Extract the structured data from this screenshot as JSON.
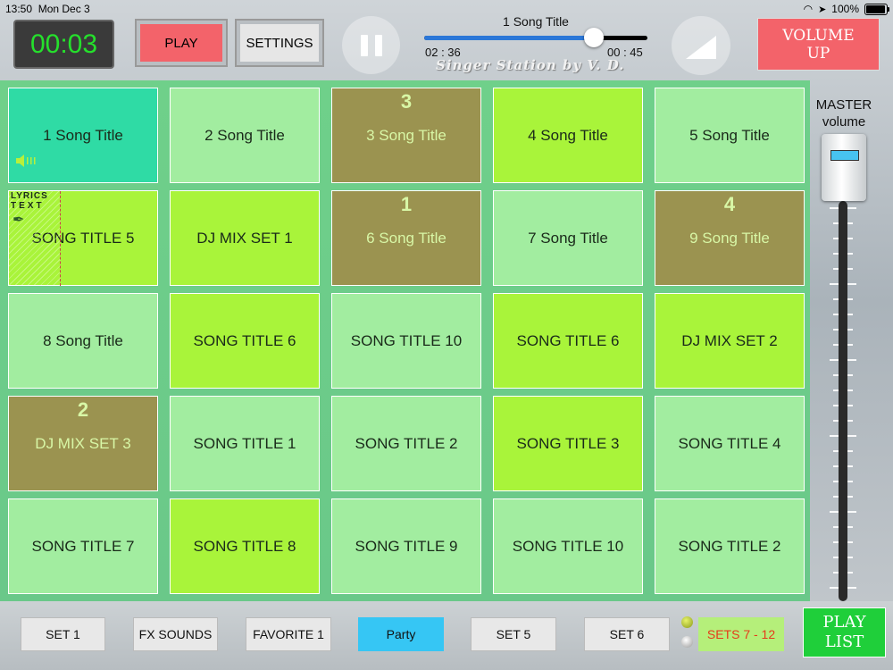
{
  "status_bar": {
    "time": "13:50",
    "date": "Mon Dec 3",
    "battery": "100%"
  },
  "timer": "00:03",
  "controls": {
    "play_label": "PLAY",
    "settings_label": "SETTINGS",
    "volume_up_label": "VOLUME UP"
  },
  "now_playing": {
    "title": "1 Song Title",
    "elapsed": "02 : 36",
    "remaining": "00 : 45",
    "progress_fraction": 0.76
  },
  "brand": "Singer Station by V. D.",
  "master": {
    "title": "MASTER",
    "subtitle": "volume"
  },
  "grid": [
    [
      "1 Song Title",
      "2 Song Title",
      "3 Song Title",
      "4 Song Title",
      "5 Song Title"
    ],
    [
      "SONG TITLE 5",
      "DJ MIX SET 1",
      "6 Song Title",
      "7 Song Title",
      "9 Song Title"
    ],
    [
      "8 Song Title",
      "SONG TITLE 6",
      "SONG TITLE 10",
      "SONG TITLE 6",
      "DJ MIX SET 2"
    ],
    [
      "DJ MIX SET 3",
      "SONG TITLE 1",
      "SONG TITLE 2",
      "SONG TITLE 3",
      "SONG TITLE 4"
    ],
    [
      "SONG TITLE 7",
      "SONG TITLE 8",
      "SONG TITLE 9",
      "SONG TITLE 10",
      "SONG TITLE 2"
    ]
  ],
  "queue_numbers": {
    "r0c2": "3",
    "r1c2": "1",
    "r1c4": "4",
    "r3c0": "2"
  },
  "lyrics_label": {
    "line1": "LYRICS",
    "line2": "TEXT"
  },
  "bottom": {
    "set1": "SET 1",
    "fx": "FX SOUNDS",
    "favorite": "FAVORITE 1",
    "party": "Party",
    "set5": "SET 5",
    "set6": "SET 6",
    "sets712": "SETS 7 - 12",
    "playlist": "PLAY LIST"
  },
  "colors": {
    "pale": "#a2eda0",
    "lime": "#a9f43a",
    "olive": "#9b9350",
    "teal": "#2fdba5",
    "party": "#36c6f4",
    "accent_red": "#f3636a"
  }
}
